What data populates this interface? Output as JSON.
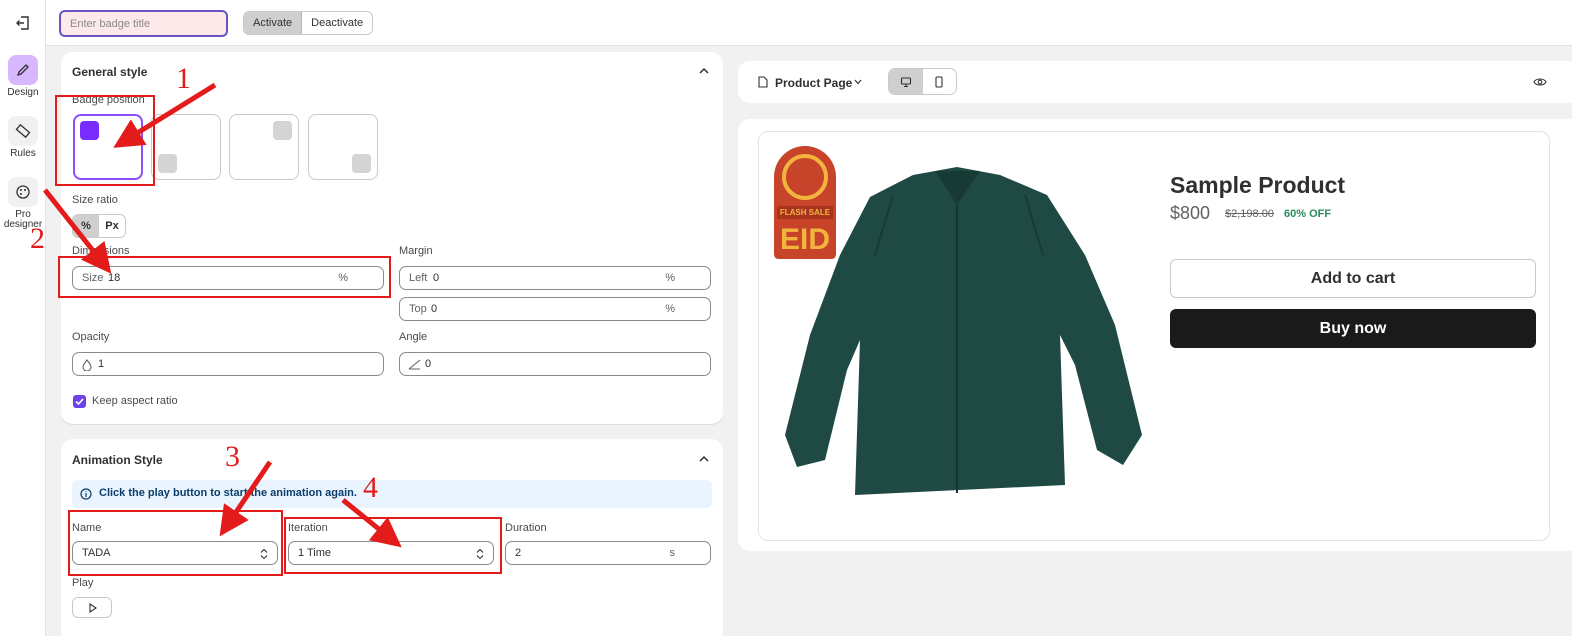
{
  "sidebar": {
    "items": [
      {
        "label": "Design"
      },
      {
        "label": "Rules"
      },
      {
        "label_line1": "Pro",
        "label_line2": "designer"
      }
    ]
  },
  "topbar": {
    "title_placeholder": "Enter badge title",
    "activate_label": "Activate",
    "deactivate_label": "Deactivate"
  },
  "general": {
    "title": "General style",
    "badge_position_label": "Badge position",
    "size_ratio_label": "Size ratio",
    "ratio_options": [
      "%",
      "Px"
    ],
    "dimensions_label": "Dimensions",
    "size_prefix": "Size",
    "size_value": "18",
    "size_unit": "%",
    "margin_label": "Margin",
    "left_prefix": "Left",
    "left_value": "0",
    "left_unit": "%",
    "top_prefix": "Top",
    "top_value": "0",
    "top_unit": "%",
    "opacity_label": "Opacity",
    "opacity_value": "1",
    "angle_label": "Angle",
    "angle_value": "0",
    "keep_aspect_label": "Keep aspect ratio"
  },
  "animation": {
    "title": "Animation Style",
    "info_text": "Click the play button to start the animation again.",
    "name_label": "Name",
    "name_value": "TADA",
    "iteration_label": "Iteration",
    "iteration_value": "1 Time",
    "duration_label": "Duration",
    "duration_value": "2",
    "duration_unit": "s",
    "play_label": "Play"
  },
  "preview": {
    "page_select": "Product Page",
    "badge_line1": "FLASH SALE",
    "badge_line2": "EID",
    "product_title": "Sample Product",
    "price": "$800",
    "compare_price": "$2,198.00",
    "discount": "60% OFF",
    "add_to_cart": "Add to cart",
    "buy_now": "Buy now"
  },
  "annotations": {
    "n1": "1",
    "n2": "2",
    "n3": "3",
    "n4": "4"
  },
  "colors": {
    "accent": "#7a2cff",
    "annotation": "#e31b1b",
    "shirt": "#1f4a44",
    "badge": "#c7432a"
  }
}
